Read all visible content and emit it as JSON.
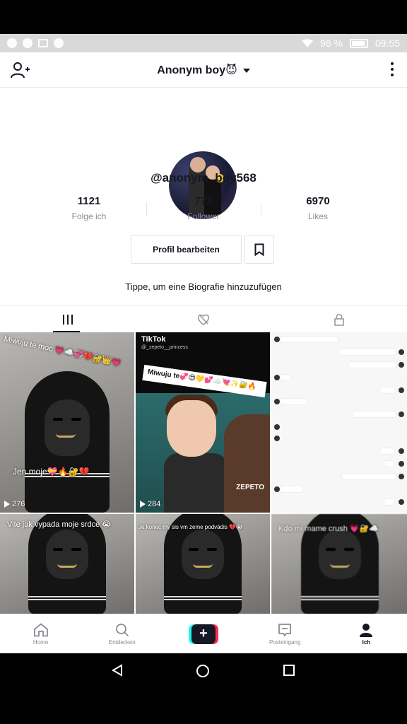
{
  "status_bar": {
    "battery": "96 %",
    "time": "09:55"
  },
  "header": {
    "title": "Anonym boy😈"
  },
  "profile": {
    "handle": "@anonym_boy568",
    "stats": [
      {
        "value": "1121",
        "label": "Folge ich"
      },
      {
        "value": "772",
        "label": "Follower"
      },
      {
        "value": "6970",
        "label": "Likes"
      }
    ],
    "edit_button": "Profil bearbeiten",
    "bio_prompt": "Tippe, um eine Biografie hinzuzufügen"
  },
  "videos": [
    {
      "caption_top": "Miwuju te moc 💗☁️💞💔🔐👑💗",
      "caption_mid": "Jen moje💝🔥🔐💔",
      "views": "276"
    },
    {
      "watermark": "TikTok",
      "watermark_sub": "@_zepeto__princess",
      "banner": "Miwuju te💞😍💛💕☁️💘✨🔐🔥",
      "brand": "ZEPETO",
      "views": "284"
    },
    {
      "type": "chat-screenshot"
    },
    {
      "caption_top": "Vite jak vypada moje srdce 😭"
    },
    {
      "caption_top": "Je konec my sis vm zeme podvádis 💔😭"
    },
    {
      "caption_top": "Kdo mi mame crush 💗🔐☁️"
    }
  ],
  "bottom_nav": {
    "items": [
      {
        "label": "Home",
        "icon": "home-icon"
      },
      {
        "label": "Entdecken",
        "icon": "search-icon"
      },
      {
        "label": "",
        "icon": "plus-icon"
      },
      {
        "label": "Posteingang",
        "icon": "inbox-icon"
      },
      {
        "label": "Ich",
        "icon": "profile-icon"
      }
    ]
  }
}
